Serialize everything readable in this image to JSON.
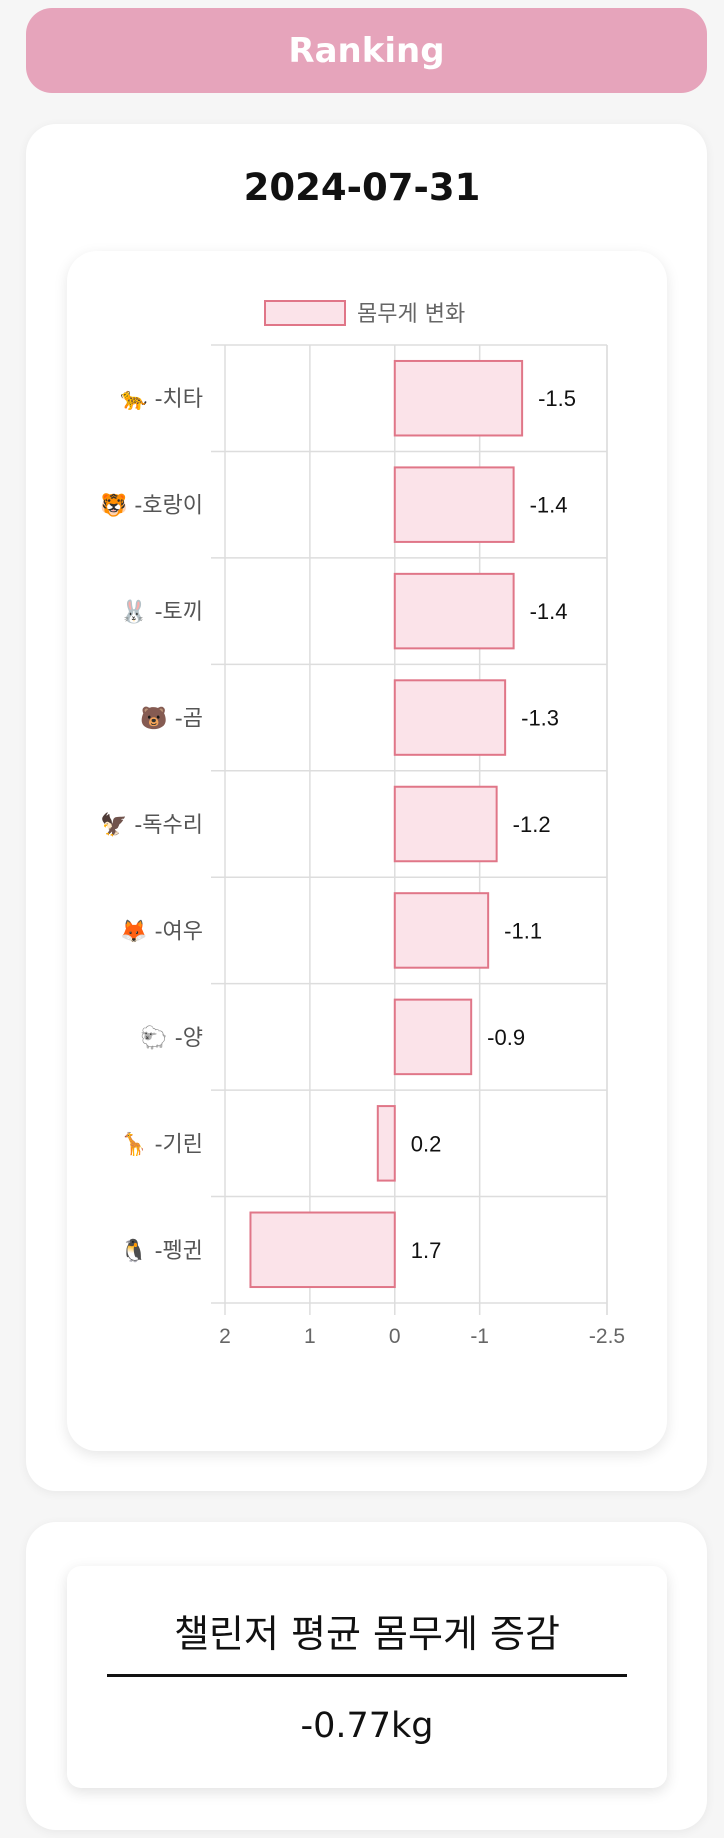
{
  "header": {
    "title": "Ranking"
  },
  "ranking": {
    "date": "2024-07-31"
  },
  "chart_data": {
    "type": "bar",
    "orientation": "horizontal",
    "x_reversed": true,
    "legend": {
      "label": "몸무게 변화",
      "position": "top"
    },
    "categories": [
      "🐆 -치타",
      "🐯 -호랑이",
      "🐰 -토끼",
      "🐻 -곰",
      "🦅 -독수리",
      "🦊 -여우",
      "🐑 -양",
      "🦒 -기린",
      "🐧 -펭귄"
    ],
    "values": [
      -1.5,
      -1.4,
      -1.4,
      -1.3,
      -1.2,
      -1.1,
      -0.9,
      0.2,
      1.7
    ],
    "data_labels": [
      "-1.5",
      "-1.4",
      "-1.4",
      "-1.3",
      "-1.2",
      "-1.1",
      "-0.9",
      "0.2",
      "1.7"
    ],
    "x_ticks": [
      2,
      1,
      0,
      -1,
      -2.5
    ],
    "x_tick_labels": [
      "2",
      "1",
      "0",
      "-1",
      "-2.5"
    ],
    "xlim": [
      2,
      -2.5
    ],
    "grid": true,
    "colors": {
      "bar_fill": "#fbe3e9",
      "bar_stroke": "#e07688",
      "grid": "#dddddd"
    }
  },
  "average": {
    "title": "챌린저 평균 몸무게 증감",
    "value": "-0.77kg"
  },
  "colors": {
    "header_bg": "#e6a4bb",
    "page_bg": "#f6f6f6"
  }
}
